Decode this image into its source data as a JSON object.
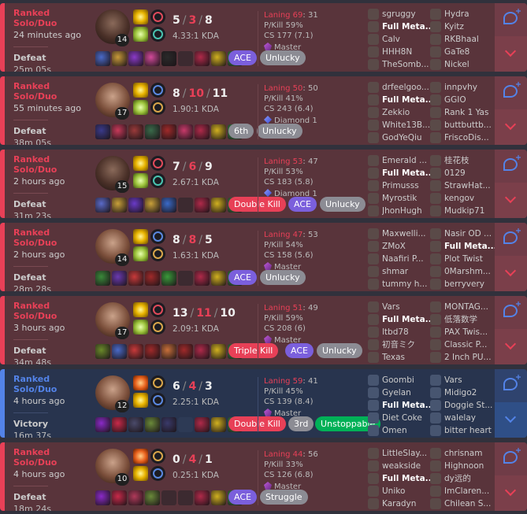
{
  "matches": [
    {
      "queue": "Ranked Solo/Duo",
      "ago": "24 minutes ago",
      "result": "Defeat",
      "duration": "25m 05s",
      "champion_level": "14",
      "kills": "5",
      "deaths": "3",
      "assists": "8",
      "kda_ratio": "4.33:1 KDA",
      "laning_label": "Laning 69",
      "laning_opp": ": 31",
      "pkill": "P/Kill 59%",
      "cs": "CS 177 (7.1)",
      "tier": "Master",
      "badges": [
        "ACE",
        "Unlucky"
      ],
      "team1": [
        "sgruggy",
        "Full Meta...",
        "Calv",
        "HHH8N",
        "TheSomb..."
      ],
      "team2": [
        "Hydra",
        "Kyitz",
        "RKBhaal",
        "GaTe8",
        "Nickel"
      ],
      "me_team": 1,
      "me_index": 1
    },
    {
      "queue": "Ranked Solo/Duo",
      "ago": "55 minutes ago",
      "result": "Defeat",
      "duration": "38m 05s",
      "champion_level": "17",
      "kills": "8",
      "deaths": "10",
      "assists": "11",
      "kda_ratio": "1.90:1 KDA",
      "laning_label": "Laning 50",
      "laning_opp": ": 50",
      "pkill": "P/Kill 41%",
      "cs": "CS 243 (6.4)",
      "tier": "Diamond 1",
      "badges": [
        "6th",
        "Unlucky"
      ],
      "team1": [
        "drfeelgoo...",
        "Full Meta...",
        "Zekkio",
        "White13B...",
        "GodYeQiu"
      ],
      "team2": [
        "innpvhy",
        "GGIO",
        "Rank 1 Yas",
        "buttbuttb...",
        "FriscoDis..."
      ],
      "me_team": 1,
      "me_index": 1
    },
    {
      "queue": "Ranked Solo/Duo",
      "ago": "2 hours ago",
      "result": "Defeat",
      "duration": "31m 23s",
      "champion_level": "15",
      "kills": "7",
      "deaths": "6",
      "assists": "9",
      "kda_ratio": "2.67:1 KDA",
      "laning_label": "Laning 53",
      "laning_opp": ": 47",
      "pkill": "P/Kill 53%",
      "cs": "CS 183 (5.8)",
      "tier": "Diamond 1",
      "badges": [
        "Double Kill",
        "ACE",
        "Unlucky"
      ],
      "team1": [
        "Emerald ...",
        "Full Meta...",
        "Primusss",
        "Myrostik",
        "JhonHugh"
      ],
      "team2": [
        "桂花枝",
        "0129",
        "StrawHat...",
        "kengov",
        "Mudkip71"
      ],
      "me_team": 1,
      "me_index": 1
    },
    {
      "queue": "Ranked Solo/Duo",
      "ago": "2 hours ago",
      "result": "Defeat",
      "duration": "28m 28s",
      "champion_level": "14",
      "kills": "8",
      "deaths": "8",
      "assists": "5",
      "kda_ratio": "1.63:1 KDA",
      "laning_label": "Laning 47",
      "laning_opp": ": 53",
      "pkill": "P/Kill 54%",
      "cs": "CS 158 (5.6)",
      "tier": "Master",
      "badges": [
        "ACE",
        "Unlucky"
      ],
      "team1": [
        "Maxwelli...",
        "ZMoX",
        "Naafiri P...",
        "shmar",
        "tummy h..."
      ],
      "team2": [
        "Nasir OD ...",
        "Full Meta...",
        "Plot Twist",
        "0Marshm...",
        "berryvery"
      ],
      "me_team": 2,
      "me_index": 1
    },
    {
      "queue": "Ranked Solo/Duo",
      "ago": "3 hours ago",
      "result": "Defeat",
      "duration": "34m 48s",
      "champion_level": "17",
      "kills": "13",
      "deaths": "11",
      "assists": "10",
      "kda_ratio": "2.09:1 KDA",
      "laning_label": "Laning 51",
      "laning_opp": ": 49",
      "pkill": "P/Kill 59%",
      "cs": "CS 208 (6)",
      "tier": "Master",
      "badges": [
        "Triple Kill",
        "ACE",
        "Unlucky"
      ],
      "team1": [
        "Vars",
        "Full Meta...",
        "ltbd78",
        "初音ミク",
        "Texas"
      ],
      "team2": [
        "MONTAG...",
        "低落数学",
        "PAX Twis...",
        "Classic P...",
        "2 Inch PU..."
      ],
      "me_team": 1,
      "me_index": 1
    },
    {
      "queue": "Ranked Solo/Duo",
      "ago": "4 hours ago",
      "result": "Victory",
      "duration": "16m 37s",
      "champion_level": "12",
      "kills": "6",
      "deaths": "4",
      "assists": "3",
      "kda_ratio": "2.25:1 KDA",
      "laning_label": "Laning 59",
      "laning_opp": ": 41",
      "pkill": "P/Kill 45%",
      "cs": "CS 139 (8.4)",
      "tier": "Master",
      "badges": [
        "Double Kill",
        "3rd",
        "Unstoppable"
      ],
      "team1": [
        "Goombi",
        "Gyelan",
        "Full Meta...",
        "Diet Coke",
        "Omen"
      ],
      "team2": [
        "Vars",
        "Midigo2",
        "Doggie St...",
        "walelay",
        "bitter heart"
      ],
      "me_team": 1,
      "me_index": 2
    },
    {
      "queue": "Ranked Solo/Duo",
      "ago": "4 hours ago",
      "result": "Defeat",
      "duration": "18m 24s",
      "champion_level": "10",
      "kills": "0",
      "deaths": "4",
      "assists": "1",
      "kda_ratio": "0.25:1 KDA",
      "laning_label": "Laning 44",
      "laning_opp": ": 56",
      "pkill": "P/Kill 33%",
      "cs": "CS 126 (6.8)",
      "tier": "Master",
      "badges": [
        "ACE",
        "Struggle"
      ],
      "team1": [
        "LittleSlay...",
        "weakside",
        "Full Meta...",
        "Uniko",
        "Karadyn"
      ],
      "team2": [
        "chrisnam",
        "Highnoon",
        "dy远的",
        "ImClaren...",
        "Chilean S..."
      ],
      "me_team": 1,
      "me_index": 2
    }
  ]
}
